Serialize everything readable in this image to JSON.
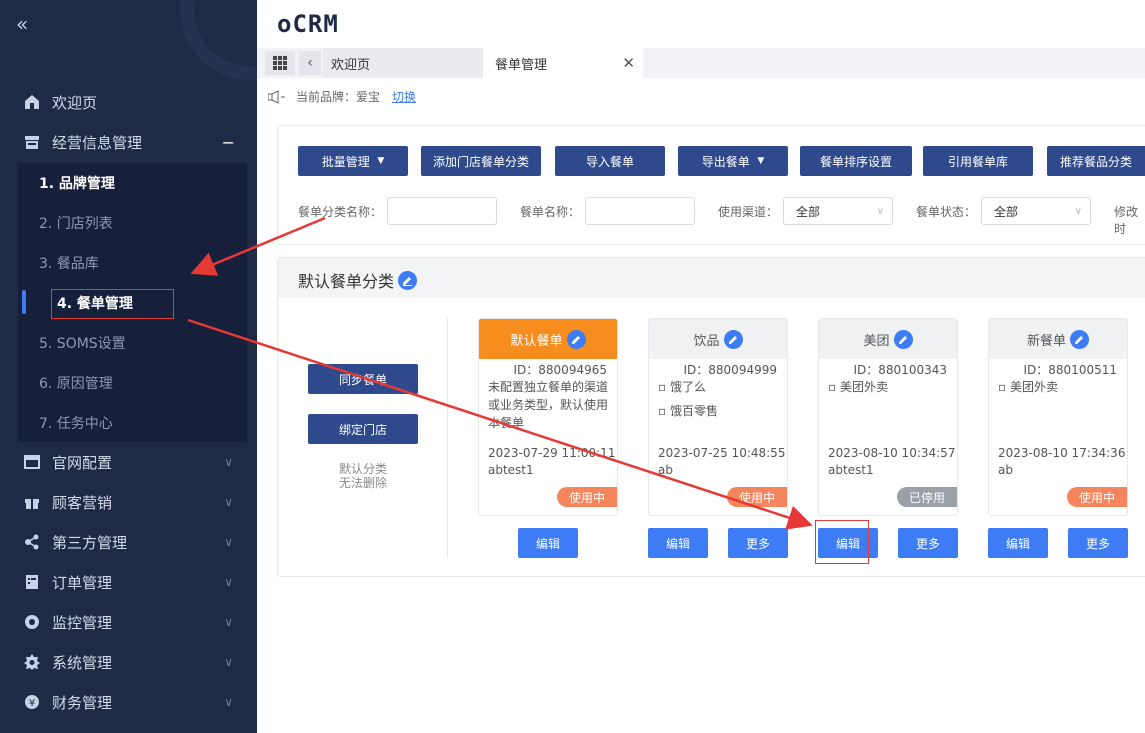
{
  "app": {
    "logo": "oCRM",
    "collapse_icon": "double-chevron-left-icon"
  },
  "sidebar": {
    "items": [
      {
        "label": "欢迎页",
        "icon": "home-icon"
      },
      {
        "label": "经营信息管理",
        "icon": "store-icon",
        "expanded": true
      },
      {
        "label": "官网配置",
        "icon": "browser-icon"
      },
      {
        "label": "顾客营销",
        "icon": "gift-icon"
      },
      {
        "label": "第三方管理",
        "icon": "share-icon"
      },
      {
        "label": "订单管理",
        "icon": "order-icon"
      },
      {
        "label": "监控管理",
        "icon": "monitor-icon"
      },
      {
        "label": "系统管理",
        "icon": "gear-icon"
      },
      {
        "label": "财务管理",
        "icon": "yen-icon"
      }
    ],
    "subitems": [
      {
        "label": "1. 品牌管理"
      },
      {
        "label": "2. 门店列表"
      },
      {
        "label": "3. 餐品库"
      },
      {
        "label": "4. 餐单管理",
        "active": true
      },
      {
        "label": "5. SOMS设置"
      },
      {
        "label": "6. 原因管理"
      },
      {
        "label": "7. 任务中心"
      }
    ]
  },
  "tabs": [
    {
      "label": "欢迎页"
    },
    {
      "label": "餐单管理",
      "active": true
    }
  ],
  "brand": {
    "label": "当前品牌：爱宝",
    "switch": "切换"
  },
  "toolbar": {
    "buttons": [
      "批量管理",
      "添加门店餐单分类",
      "导入餐单",
      "导出餐单",
      "餐单排序设置",
      "引用餐单库",
      "推荐餐品分类"
    ]
  },
  "filters": {
    "category_label": "餐单分类名称：",
    "category_value": "",
    "menu_label": "餐单名称：",
    "menu_value": "",
    "channel_label": "使用渠道：",
    "channel_value": "全部",
    "status_label": "餐单状态：",
    "status_value": "全部",
    "modify_label": "修改时"
  },
  "category": {
    "title": "默认餐单分类",
    "sync_button": "同步餐单",
    "bind_button": "绑定门店",
    "note_line1": "默认分类",
    "note_line2": "无法删除"
  },
  "cards": [
    {
      "name": "默认餐单",
      "id": "ID：880094965",
      "desc": "未配置独立餐单的渠道或业务类型，默认使用本餐单",
      "date": "2023-07-29 11:00:11",
      "user": "abtest1",
      "status": "使用中"
    },
    {
      "name": "饮品",
      "id": "ID：880094999",
      "desc1": "▫ 饿了么",
      "desc2": "▫ 饿百零售",
      "date": "2023-07-25 10:48:55",
      "user": "ab",
      "status": "使用中"
    },
    {
      "name": "美团",
      "id": "ID：880100343",
      "desc1": "▫ 美团外卖",
      "date": "2023-08-10 10:34:57",
      "user": "abtest1",
      "status": "已停用"
    },
    {
      "name": "新餐单",
      "id": "ID：880100511",
      "desc1": "▫ 美团外卖",
      "date": "2023-08-10 17:34:36",
      "user": "ab",
      "status": "使用中"
    }
  ],
  "card_actions": {
    "edit": "编辑",
    "more": "更多"
  },
  "colors": {
    "sidebar": "#1f2a44",
    "accent": "#3d7cf5",
    "dark_button": "#2f4a8c",
    "orange": "#f78c1f",
    "annotation": "#e53935"
  }
}
